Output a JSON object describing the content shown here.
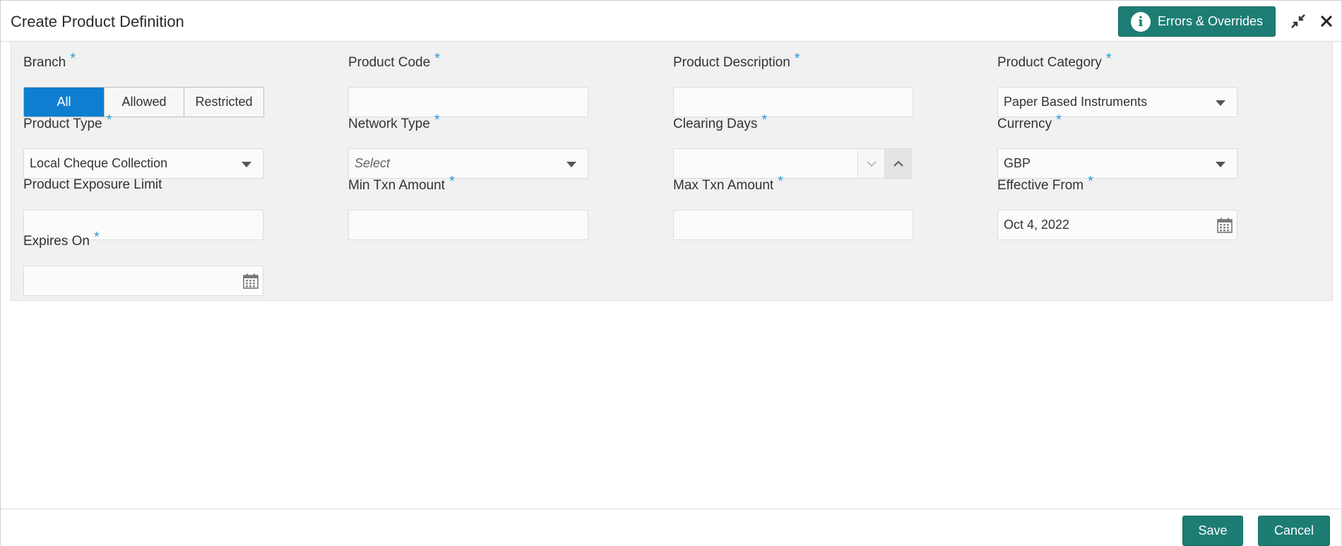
{
  "window": {
    "title": "Create Product Definition"
  },
  "header": {
    "errors_label": "Errors & Overrides"
  },
  "form": {
    "branch": {
      "label": "Branch",
      "options": [
        "All",
        "Allowed",
        "Restricted"
      ],
      "selected": "All"
    },
    "product_code": {
      "label": "Product Code",
      "value": ""
    },
    "product_description": {
      "label": "Product Description",
      "value": ""
    },
    "product_category": {
      "label": "Product Category",
      "value": "Paper Based Instruments"
    },
    "product_type": {
      "label": "Product Type",
      "value": "Local Cheque Collection"
    },
    "network_type": {
      "label": "Network Type",
      "placeholder": "Select"
    },
    "clearing_days": {
      "label": "Clearing Days",
      "value": ""
    },
    "currency": {
      "label": "Currency",
      "value": "GBP"
    },
    "product_exposure_limit": {
      "label": "Product Exposure Limit",
      "value": ""
    },
    "min_txn_amount": {
      "label": "Min Txn Amount",
      "value": ""
    },
    "max_txn_amount": {
      "label": "Max Txn Amount",
      "value": ""
    },
    "effective_from": {
      "label": "Effective From",
      "value": "Oct 4, 2022"
    },
    "expires_on": {
      "label": "Expires On",
      "value": ""
    },
    "required_mark": "*"
  },
  "footer": {
    "save_label": "Save",
    "cancel_label": "Cancel"
  },
  "colors": {
    "primary": "#1d7d74",
    "segment_active": "#0f7ed1",
    "required": "#2a9bd6",
    "panel_bg": "#f1f1f1"
  },
  "icons": [
    "info-icon",
    "minimize-icon",
    "close-icon",
    "chevron-down-icon",
    "chevron-up-icon",
    "calendar-icon"
  ]
}
